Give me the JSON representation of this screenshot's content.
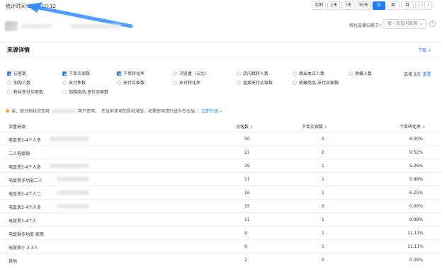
{
  "topbar": {
    "stat_time": "统计时间 2019-10-12",
    "ranges": [
      {
        "label": "实时",
        "active": false
      },
      {
        "label": "1天",
        "active": false
      },
      {
        "label": "7天",
        "active": false
      },
      {
        "label": "30天",
        "active": false
      },
      {
        "label": "日",
        "active": true
      },
      {
        "label": "周",
        "active": false
      },
      {
        "label": "月",
        "active": false
      }
    ],
    "prev_glyph": "‹",
    "next_glyph": "›"
  },
  "header": {
    "attribution_label": "转化效果归属于：",
    "attribution_value": "每一次访问来源",
    "chevron_glyph": "⌄",
    "help_glyph": "?"
  },
  "section": {
    "title": "来源详情",
    "download": "下载 ⇓"
  },
  "metrics": [
    {
      "label": "访客数",
      "checked": true,
      "kind": "cb"
    },
    {
      "label": "下单买家数",
      "checked": true,
      "kind": "cb"
    },
    {
      "label": "下单转化率",
      "checked": true,
      "kind": "cb"
    },
    {
      "label": "浏览量（占比）",
      "checked": false,
      "kind": "rb"
    },
    {
      "label": "店内跳转人数",
      "checked": false,
      "kind": "rb"
    },
    {
      "label": "跳出本店人数",
      "checked": false,
      "kind": "rb"
    },
    {
      "label": "收藏人数",
      "checked": false,
      "kind": "rb"
    },
    {
      "label": "加购人数",
      "checked": false,
      "kind": "rb"
    },
    {
      "label": "支付件数",
      "checked": false,
      "kind": "rb"
    },
    {
      "label": "支付买家数",
      "checked": false,
      "kind": "rb"
    },
    {
      "label": "支付转化率",
      "checked": false,
      "kind": "rb"
    },
    {
      "label": "直接支付买家数",
      "checked": false,
      "kind": "rb"
    },
    {
      "label": "收藏商品-支付买家数",
      "checked": false,
      "kind": "rb"
    },
    {
      "label": "粉丝支付买家数",
      "checked": false,
      "kind": "rb"
    },
    {
      "label": "加购商品-支付买家数",
      "checked": false,
      "kind": "rb"
    }
  ],
  "select_count": "选择 3/5",
  "reset": "重置",
  "tip": {
    "text": "亲，部分指标仅支持",
    "text2": "用户使用，",
    "text3": "您当前使用的是标准版，如需使用请升级为专业版。",
    "upgrade": "立即升级 »"
  },
  "table": {
    "headers": {
      "source": "流量来源",
      "visitors": "访客数",
      "buyers": "下单买家数",
      "conversion": "下单转化率"
    },
    "sort_glyph": "⇅",
    "rows": [
      {
        "source": "电饭煲3-4个人多",
        "visitors": "50",
        "buyers": "3",
        "conversion": "6.00%"
      },
      {
        "source": "二人电饭锅",
        "visitors": "21",
        "buyers": "2",
        "conversion": "9.52%"
      },
      {
        "source": "电饭煲3-4个人多",
        "visitors": "19",
        "buyers": "1",
        "conversion": "5.26%"
      },
      {
        "source": "电饭煲多功能二人",
        "visitors": "17",
        "buyers": "1",
        "conversion": "5.88%"
      },
      {
        "source": "电饭煲3-4个人二",
        "visitors": "16",
        "buyers": "1",
        "conversion": "6.25%"
      },
      {
        "source": "电饭煲3-4个人多",
        "visitors": "15",
        "buyers": "0",
        "conversion": "0.00%"
      },
      {
        "source": "电饭煲3-4个人",
        "visitors": "11",
        "buyers": "1",
        "conversion": "9.09%"
      },
      {
        "source": "电饭锅多功能 家用",
        "visitors": "9",
        "buyers": "1",
        "conversion": "11.11%"
      },
      {
        "source": "电饭煲小 2-3人",
        "visitors": "9",
        "buyers": "1",
        "conversion": "11.11%"
      },
      {
        "source": "其他",
        "visitors": "2",
        "buyers": "0",
        "conversion": "0.00%"
      }
    ]
  },
  "colors": {
    "accent": "#1f7cff",
    "warning": "#f5a623"
  }
}
